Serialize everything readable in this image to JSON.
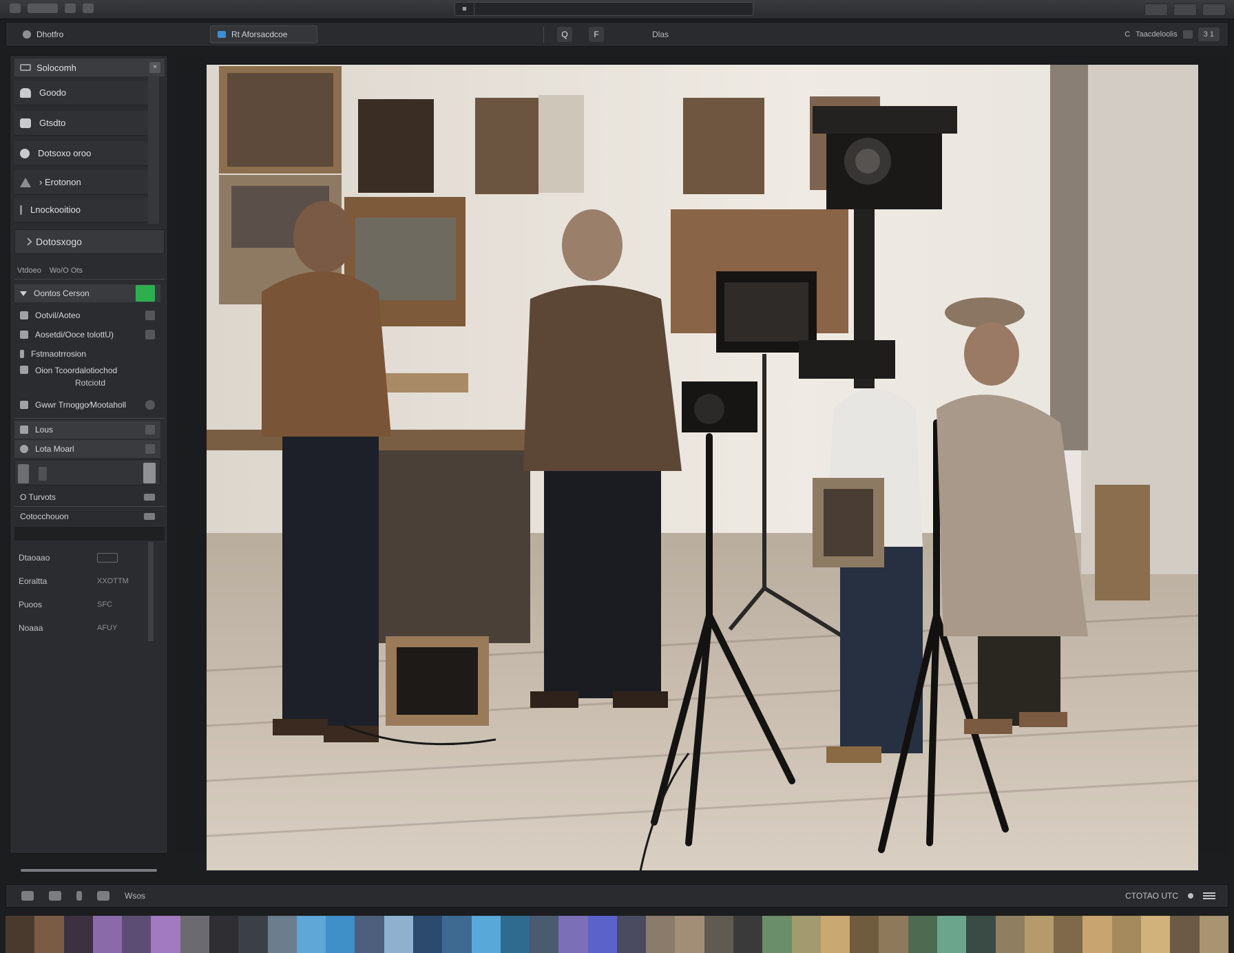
{
  "titlebar": {
    "pin": "■",
    "path": "",
    "btn_left": "",
    "btn_mid": "",
    "btn_right": ""
  },
  "tabs": {
    "file_label": "Dhotfro",
    "doc_label": "Rt Aforsacdcoe",
    "tool_1": "Q",
    "tool_2": "F",
    "center_label": "Dlas",
    "right_c": "C",
    "right_label": "Taacdeloolis",
    "right_btn": "3 1"
  },
  "sidebar": {
    "header": "Solocomh",
    "rows": [
      {
        "label": "Goodo",
        "icon": "brush-icon"
      },
      {
        "label": "Gtsdto",
        "icon": "square-icon"
      },
      {
        "label": "Dotsoxo oroo",
        "icon": "circle-icon"
      },
      {
        "label": "› Erotonon",
        "icon": "triangle-icon"
      },
      {
        "label": "Lnockooitioo",
        "icon": "line-icon"
      }
    ],
    "section": "Dotosxogo",
    "layers_label_a": "Vtdoeo",
    "layers_label_b": "Wo/O Ots",
    "layers": [
      {
        "label": "Oontos Cerson"
      },
      {
        "label": "Ootvil/Aoteo"
      },
      {
        "label": "Aosetdi/Ooce tolottU)"
      },
      {
        "label": "Fstmaotrrosion"
      },
      {
        "label": "Oion Tcoordalotiochod",
        "sub": "Rotciotd"
      },
      {
        "label": "Gwwr Trnoggo⁄Mootaholl"
      }
    ],
    "plain": [
      {
        "label": "Lous"
      },
      {
        "label": "Lota Moarl"
      }
    ],
    "flags": [
      {
        "label": "O Turvots"
      },
      {
        "label": "Cotocchouon"
      }
    ],
    "props": [
      {
        "label": "Dtaoaao",
        "value": ""
      },
      {
        "label": "Eoraltta",
        "value": "XXOTTM"
      },
      {
        "label": "Puoos",
        "value": "SFC"
      },
      {
        "label": "Noaaa",
        "value": "AFUY"
      }
    ]
  },
  "statusbar": {
    "left_label": "Wsos",
    "right_label": "CTOTAO UTC"
  },
  "filmstrip": [
    "#4a3a2e",
    "#7a5b43",
    "#3d3040",
    "#8a6aa8",
    "#5c4e72",
    "#a27ac0",
    "#6b6a70",
    "#2f2e33",
    "#3b3f48",
    "#6c7e8e",
    "#5ea7d6",
    "#3f8fc9",
    "#4d5f7c",
    "#8fb1cf",
    "#2b4a6d",
    "#3e6a92",
    "#58a9d8",
    "#2e6b8f",
    "#4a5a6f",
    "#7b6fb8",
    "#5b62c9",
    "#4a4a60",
    "#8a7b6a",
    "#a28e76",
    "#605a52",
    "#3a3a3a",
    "#6a8e6a",
    "#a39a6f",
    "#c9a872",
    "#6f5b3e",
    "#8e7a5b",
    "#4e6b52",
    "#6aa58c",
    "#3a4a44",
    "#8f7e60",
    "#b59b6c",
    "#7e6a4a",
    "#c8a470",
    "#a58a5e",
    "#d0b27a",
    "#6b5a46",
    "#a89470"
  ]
}
